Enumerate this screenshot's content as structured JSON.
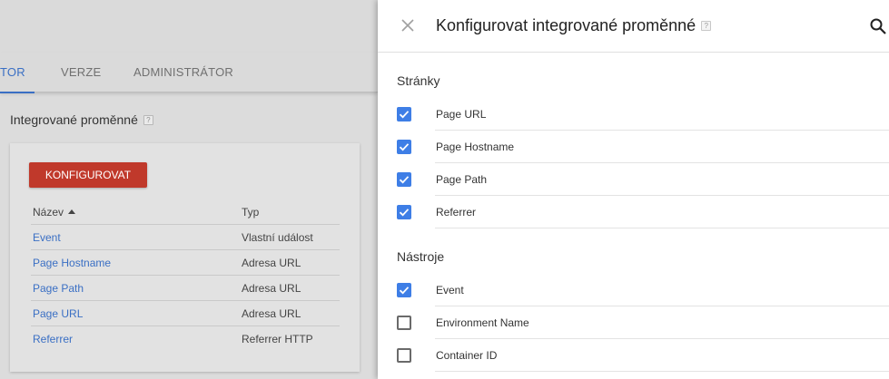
{
  "background": {
    "tabs": [
      {
        "label": "TOR",
        "active": true
      },
      {
        "label": "VERZE",
        "active": false
      },
      {
        "label": "ADMINISTRÁTOR",
        "active": false
      }
    ],
    "section_title": "Integrované proměnné",
    "help_glyph": "?",
    "configure_label": "KONFIGUROVAT",
    "table": {
      "headers": {
        "name": "Název",
        "type": "Typ"
      },
      "rows": [
        {
          "name": "Event",
          "type": "Vlastní událost"
        },
        {
          "name": "Page Hostname",
          "type": "Adresa URL"
        },
        {
          "name": "Page Path",
          "type": "Adresa URL"
        },
        {
          "name": "Page URL",
          "type": "Adresa URL"
        },
        {
          "name": "Referrer",
          "type": "Referrer HTTP"
        }
      ]
    }
  },
  "panel": {
    "title": "Konfigurovat integrované proměnné",
    "help_glyph": "?",
    "close_icon": "close-icon",
    "search_icon": "search-icon",
    "groups": [
      {
        "label": "Stránky",
        "items": [
          {
            "label": "Page URL",
            "checked": true
          },
          {
            "label": "Page Hostname",
            "checked": true
          },
          {
            "label": "Page Path",
            "checked": true
          },
          {
            "label": "Referrer",
            "checked": true
          }
        ]
      },
      {
        "label": "Nástroje",
        "items": [
          {
            "label": "Event",
            "checked": true
          },
          {
            "label": "Environment Name",
            "checked": false
          },
          {
            "label": "Container ID",
            "checked": false
          }
        ]
      }
    ]
  },
  "colors": {
    "accent_blue": "#3e7ee6",
    "link_blue": "#3a6fc4",
    "button_red": "#c0392b"
  }
}
